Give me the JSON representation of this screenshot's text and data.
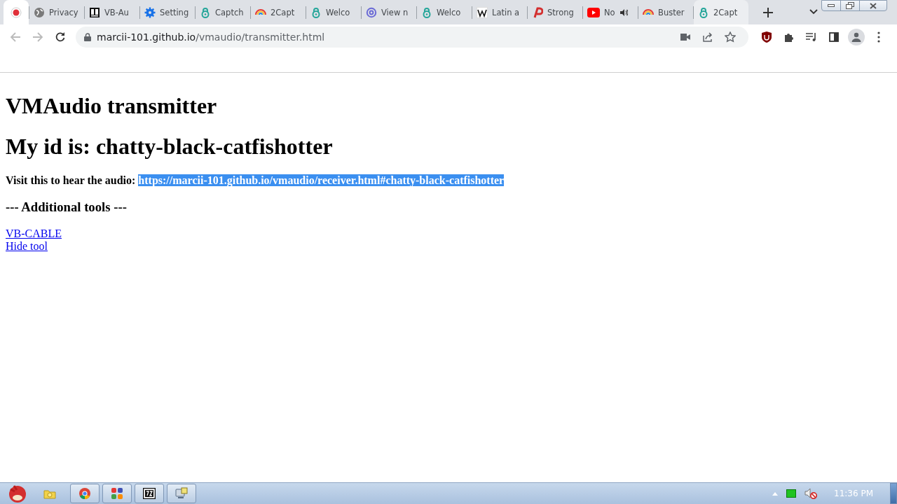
{
  "tabs": [
    {
      "kind": "record",
      "selected": true,
      "audio": false
    },
    {
      "kind": "globe",
      "title": "Privacy",
      "selected": false,
      "audio": false
    },
    {
      "kind": "vb",
      "title": "VB-Au",
      "selected": false,
      "audio": false
    },
    {
      "kind": "gear",
      "title": "Setting",
      "selected": false,
      "audio": false
    },
    {
      "kind": "lock",
      "title": "Captch",
      "selected": false,
      "audio": false
    },
    {
      "kind": "rainbow",
      "title": "2Capt",
      "selected": false,
      "audio": false
    },
    {
      "kind": "lock",
      "title": "Welco",
      "selected": false,
      "audio": false
    },
    {
      "kind": "at",
      "title": "View n",
      "selected": false,
      "audio": false
    },
    {
      "kind": "lock",
      "title": "Welco",
      "selected": false,
      "audio": false
    },
    {
      "kind": "wiki",
      "title": "Latin a",
      "selected": false,
      "audio": false
    },
    {
      "kind": "p",
      "title": "Strong",
      "selected": false,
      "audio": false
    },
    {
      "kind": "play",
      "title": "No",
      "selected": false,
      "audio": true
    },
    {
      "kind": "rainbow",
      "title": "Buster",
      "selected": false,
      "audio": false
    },
    {
      "kind": "lock",
      "title": "2Capt",
      "selected": false,
      "audio": false,
      "hovered": true
    }
  ],
  "address_bar": {
    "host": "marcii-101.github.io",
    "path": "/vmaudio/transmitter.html"
  },
  "page": {
    "title": "VMAudio transmitter",
    "id_heading": "My id is: chatty-black-catfishotter",
    "visit_label": "Visit this to hear the audio: ",
    "receiver_link": {
      "text": "https://marcii-101.github.io/vmaudio/receiver.html#chatty-black-catfishotter",
      "selected": true
    },
    "tools_heading": "--- Additional tools ---",
    "tool_links": [
      "VB-CABLE",
      "Hide tool"
    ]
  },
  "taskbar": {
    "apps": [
      {
        "kind": "folder"
      },
      {
        "kind": "chrome"
      },
      {
        "kind": "grid"
      },
      {
        "kind": "archive"
      },
      {
        "kind": "remote"
      }
    ],
    "clock": "11:36 PM"
  }
}
